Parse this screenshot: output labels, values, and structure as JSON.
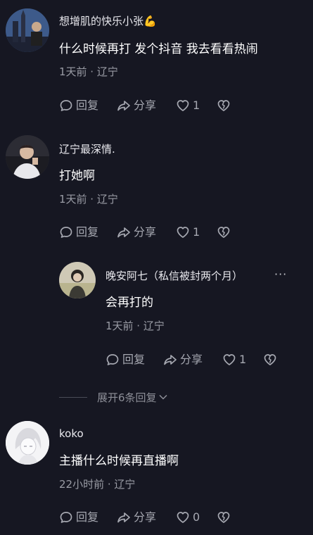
{
  "comments": [
    {
      "username": "想增肌的快乐小张💪",
      "text": "什么时候再打 发个抖音 我去看看热闹",
      "meta": "1天前 · 辽宁",
      "reply_label": "回复",
      "share_label": "分享",
      "likes": "1"
    },
    {
      "username": "辽宁最深情.",
      "text": "打她啊",
      "meta": "1天前 · 辽宁",
      "reply_label": "回复",
      "share_label": "分享",
      "likes": "1"
    },
    {
      "username": "晚安阿七（私信被封两个月）",
      "text": "会再打的",
      "meta": "1天前 · 辽宁",
      "reply_label": "回复",
      "share_label": "分享",
      "likes": "1",
      "more": "···"
    },
    {
      "username": "koko",
      "text": "主播什么时候再直播啊",
      "meta": "22小时前 · 辽宁",
      "reply_label": "回复",
      "share_label": "分享",
      "likes": "0"
    }
  ],
  "expand_replies": "展开6条回复"
}
